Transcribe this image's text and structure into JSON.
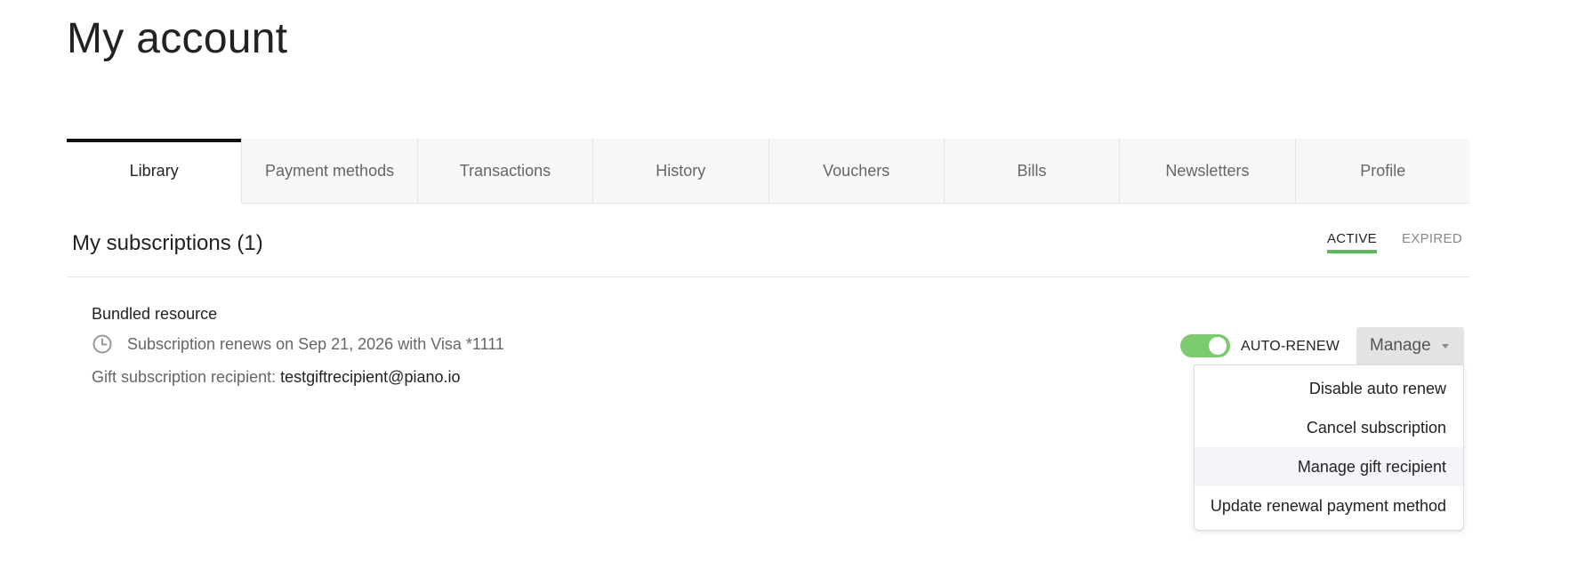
{
  "page": {
    "title": "My account"
  },
  "tabs": [
    {
      "label": "Library",
      "active": true
    },
    {
      "label": "Payment methods"
    },
    {
      "label": "Transactions"
    },
    {
      "label": "History"
    },
    {
      "label": "Vouchers"
    },
    {
      "label": "Bills"
    },
    {
      "label": "Newsletters"
    },
    {
      "label": "Profile"
    }
  ],
  "subscriptions": {
    "title": "My subscriptions (1)",
    "filters": {
      "active": "ACTIVE",
      "expired": "EXPIRED",
      "selected": "active"
    },
    "items": [
      {
        "name": "Bundled resource",
        "renewal_text": "Subscription renews on Sep 21, 2026 with Visa *1111",
        "gift_label": "Gift subscription recipient:",
        "gift_email": "testgiftrecipient@piano.io",
        "auto_renew_label": "AUTO-RENEW",
        "auto_renew_on": true,
        "manage_label": "Manage",
        "manage_menu": [
          {
            "label": "Disable auto renew"
          },
          {
            "label": "Cancel subscription"
          },
          {
            "label": "Manage gift recipient",
            "highlighted": true
          },
          {
            "label": "Update renewal payment method"
          }
        ]
      }
    ]
  },
  "colors": {
    "accent_green": "#5cb85c",
    "toggle_green": "#7ccc6f",
    "active_tab_border": "#111111",
    "menu_highlight": "#f3f5f9"
  },
  "icons": {
    "renewal": "clock-icon",
    "manage_caret": "chevron-down-icon"
  }
}
